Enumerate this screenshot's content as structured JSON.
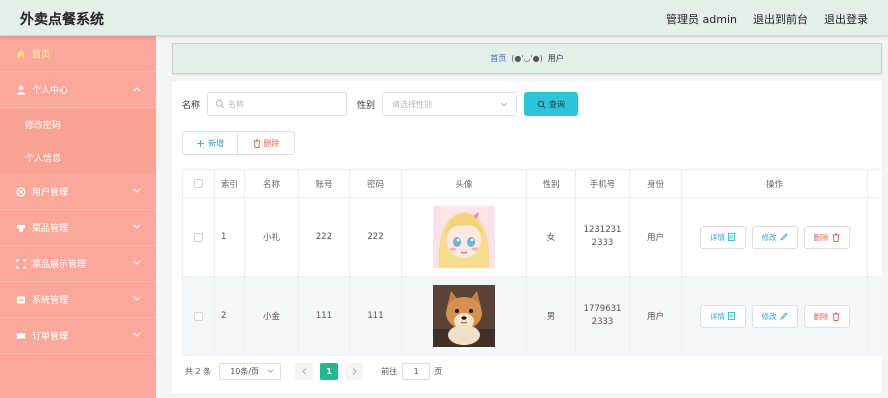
{
  "app": {
    "title": "外卖点餐系统"
  },
  "topbar": {
    "user": "管理员 admin",
    "front": "退出到前台",
    "logout": "退出登录"
  },
  "sidebar": {
    "home": "首页",
    "personal": "个人中心",
    "change_password": "修改密码",
    "profile": "个人信息",
    "user_mgmt": "用户管理",
    "dish_mgmt": "菜品管理",
    "display_mgmt": "菜品展示管理",
    "system_mgmt": "系统管理",
    "order_mgmt": "订单管理"
  },
  "breadcrumb": {
    "home": "首页",
    "sep": "(●'◡'●)",
    "current": "用户"
  },
  "search": {
    "name_label": "名称",
    "name_placeholder": "名称",
    "gender_label": "性别",
    "gender_placeholder": "请选择性别",
    "query_button": "查询"
  },
  "actions": {
    "add": "新增",
    "delete": "删除"
  },
  "table": {
    "headers": {
      "index": "索引",
      "name": "名称",
      "account": "账号",
      "password": "密码",
      "avatar": "头像",
      "gender": "性别",
      "phone": "手机号",
      "role": "身份",
      "ops": "操作"
    },
    "rows": [
      {
        "index": "1",
        "name": "小礼",
        "account": "222",
        "password": "222",
        "gender": "女",
        "phone_a": "1231231",
        "phone_b": "2333",
        "role": "用户"
      },
      {
        "index": "2",
        "name": "小金",
        "account": "111",
        "password": "111",
        "gender": "男",
        "phone_a": "1779631",
        "phone_b": "2333",
        "role": "用户"
      }
    ],
    "ops": {
      "detail": "详情",
      "edit": "修改",
      "delete": "删除"
    }
  },
  "pager": {
    "total": "共 2 条",
    "page_size": "10条/页",
    "current": "1",
    "goto_label": "前往",
    "goto_value": "1",
    "page_suffix": "页"
  },
  "colors": {
    "sidebar": "#f9a89b",
    "topbar": "#e4efe9",
    "accent": "#2ec4d8",
    "active_page": "#1fb892",
    "danger": "#f0604d"
  }
}
